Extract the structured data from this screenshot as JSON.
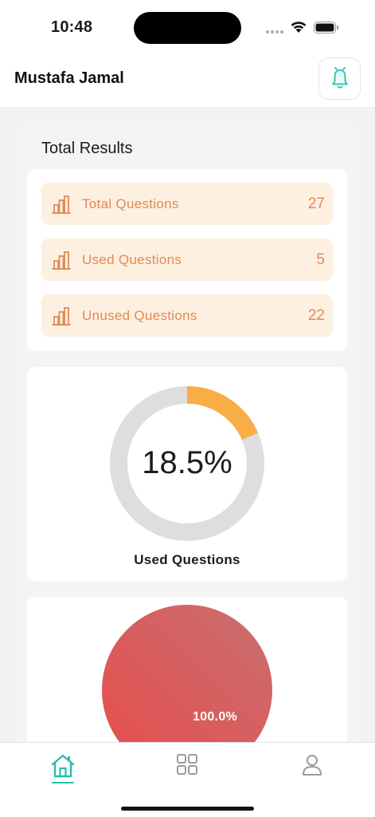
{
  "status_bar": {
    "time": "10:48"
  },
  "header": {
    "user_name": "Mustafa Jamal"
  },
  "results": {
    "title": "Total Results",
    "items": [
      {
        "label": "Total Questions",
        "value": "27",
        "icon": "bar-chart-icon"
      },
      {
        "label": "Used Questions",
        "value": "5",
        "icon": "bar-chart-icon"
      },
      {
        "label": "Unused Questions",
        "value": "22",
        "icon": "bar-chart-icon"
      }
    ]
  },
  "donut": {
    "percent_label": "18.5%",
    "fraction": 0.185,
    "caption": "Used Questions"
  },
  "pie": {
    "percent_label": "100.0%",
    "fraction": 1.0
  },
  "tabs": [
    {
      "name": "home",
      "icon": "home-icon",
      "active": true
    },
    {
      "name": "grid",
      "icon": "grid-icon",
      "active": false
    },
    {
      "name": "profile",
      "icon": "user-icon",
      "active": false
    }
  ],
  "colors": {
    "accent": "#2bbcb0",
    "stat_text": "#e08a55",
    "stat_bg": "#fdf0e1",
    "donut_fill": "#f8ad46",
    "donut_track": "#dedede",
    "pie_start": "#e84c4c",
    "pie_end": "#c86f70"
  }
}
